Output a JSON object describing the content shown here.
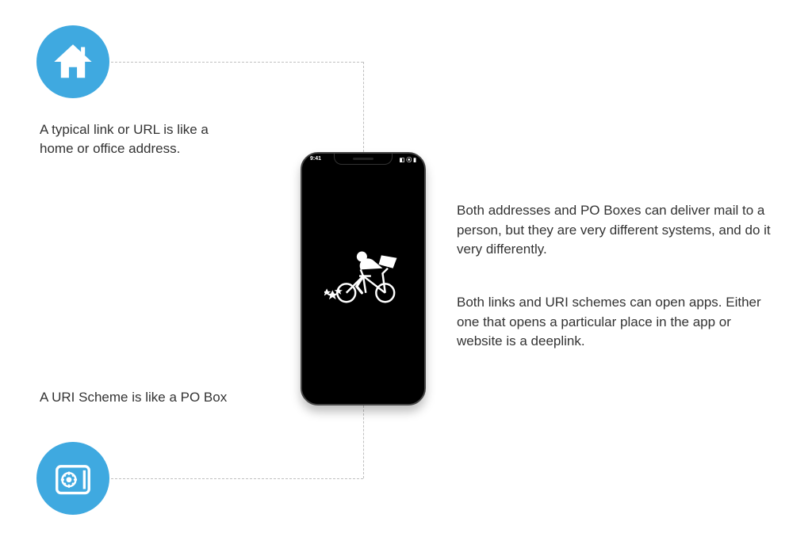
{
  "accent_color": "#3fa9e0",
  "top_icon": {
    "name": "home-icon"
  },
  "bottom_icon": {
    "name": "safe-icon"
  },
  "captions": {
    "url_label": "A typical link or URL is like a home or office address.",
    "uri_label": "A URI Scheme is like a PO Box"
  },
  "right_blocks": {
    "block1": "Both addresses and PO Boxes can deliver mail to a person, but they are very different systems, and do it very differently.",
    "block2": "Both links and URI schemes can open apps. Either one that opens a particular place in the app or website is a deeplink."
  },
  "phone": {
    "time": "9:41",
    "status_icons": "◧ ⦿ ▮"
  }
}
